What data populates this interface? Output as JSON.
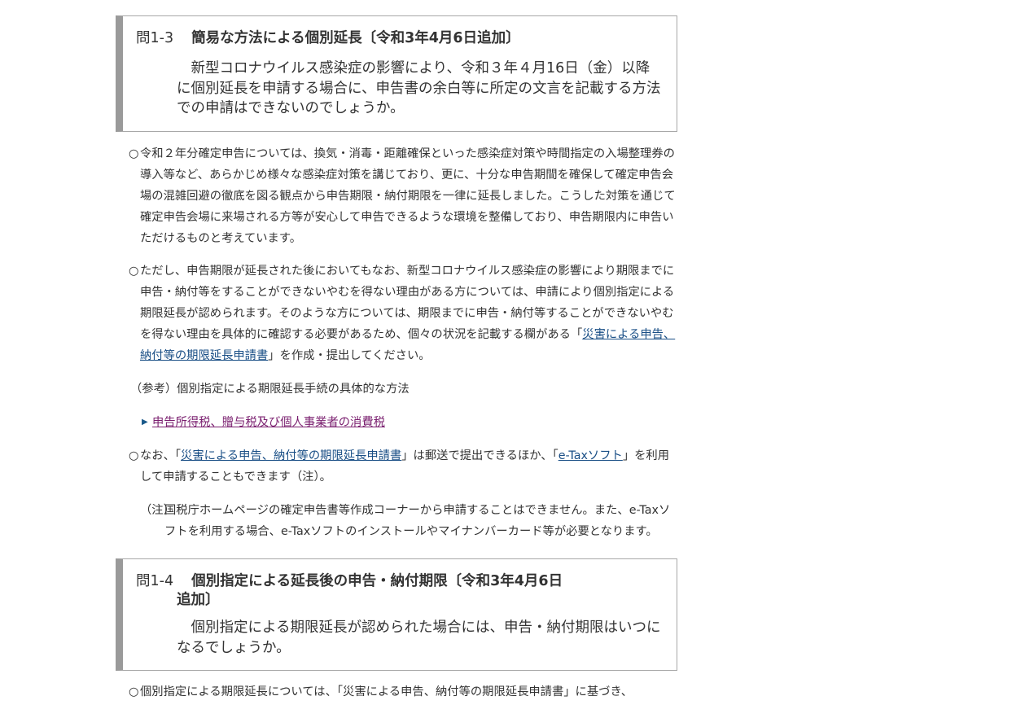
{
  "q13": {
    "num": "問1-3",
    "title": "簡易な方法による個別延長〔令和3年4月6日追加〕",
    "question": "新型コロナウイルス感染症の影響により、令和３年４月16日（金）以降に個別延長を申請する場合に、申告書の余白等に所定の文言を記載する方法での申請はできないのでしょうか。"
  },
  "answer1": {
    "mark": "○",
    "text": "令和２年分確定申告については、換気・消毒・距離確保といった感染症対策や時間指定の入場整理券の導入等など、あらかじめ様々な感染症対策を講じており、更に、十分な申告期間を確保して確定申告会場の混雑回避の徹底を図る観点から申告期限・納付期限を一律に延長しました。こうした対策を通じて確定申告会場に来場される方等が安心して申告できるような環境を整備しており、申告期限内に申告いただけるものと考えています。"
  },
  "answer2": {
    "mark": "○",
    "text_before": "ただし、申告期限が延長された後においてもなお、新型コロナウイルス感染症の影響により期限までに申告・納付等をすることができないやむを得ない理由がある方については、申請により個別指定による期限延長が認められます。そのような方については、期限までに申告・納付等することができないやむを得ない理由を具体的に確認する必要があるため、個々の状況を記載する欄がある「",
    "link": "災害による申告、納付等の期限延長申請書",
    "text_after": "」を作成・提出してください。"
  },
  "reference": {
    "text": "（参考）個別指定による期限延長手続の具体的な方法",
    "bullet_glyph": "▶",
    "link": "申告所得税、贈与税及び個人事業者の消費税"
  },
  "answer3": {
    "mark": "○",
    "text1": "なお、「",
    "link1": "災害による申告、納付等の期限延長申請書",
    "text2": "」は郵送で提出できるほか、「",
    "link2": "e-Taxソフト",
    "text3": "」を利用して申請することもできます（注）。"
  },
  "note": {
    "mark": "（注）",
    "text": "国税庁ホームページの確定申告書等作成コーナーから申請することはできません。また、e-Taxソフトを利用する場合、e-Taxソフトのインストールやマイナンバーカード等が必要となります。"
  },
  "q14": {
    "num": "問1-4",
    "title_line1": "個別指定による延長後の申告・納付期限〔令和3年4月6日",
    "title_line2": "追加〕",
    "question": "個別指定による期限延長が認められた場合には、申告・納付期限はいつになるでしょうか。"
  },
  "answer4": {
    "mark": "○",
    "text": "個別指定による期限延長については、「災害による申告、納付等の期限延長申請書」に基づき、"
  }
}
